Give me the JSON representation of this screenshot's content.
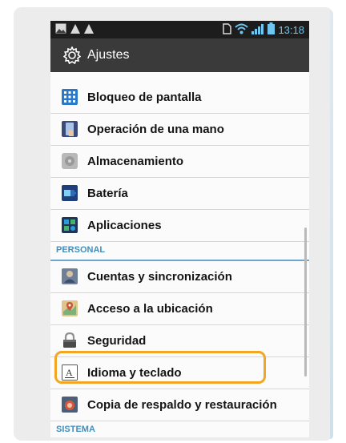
{
  "status_bar": {
    "time": "13:18",
    "icons": [
      "image-icon",
      "warning-icon",
      "warning-icon",
      "sim-icon",
      "wifi-icon",
      "signal-icon",
      "battery-icon"
    ]
  },
  "action_bar": {
    "icon": "gear-icon",
    "title": "Ajustes"
  },
  "list": {
    "items_top": [
      {
        "label": "Bloqueo de pantalla",
        "icon": "grid-lock-icon",
        "color": "#2a78c8"
      },
      {
        "label": "Operación de una mano",
        "icon": "hand-icon",
        "color": "#3a4a7a"
      },
      {
        "label": "Almacenamiento",
        "icon": "storage-icon",
        "color": "#9a9a9a"
      },
      {
        "label": "Batería",
        "icon": "battery-icon",
        "color": "#2c6db3"
      },
      {
        "label": "Aplicaciones",
        "icon": "apps-icon",
        "color": "#2a9ed4"
      }
    ],
    "section_personal": "PERSONAL",
    "items_personal": [
      {
        "label": "Cuentas y sincronización",
        "icon": "accounts-icon",
        "color": "#6f7f98"
      },
      {
        "label": "Acceso a la ubicación",
        "icon": "location-icon",
        "color": "#c9583a"
      },
      {
        "label": "Seguridad",
        "icon": "padlock-icon",
        "color": "#8f8f8f"
      },
      {
        "label": "Idioma y teclado",
        "icon": "keyboard-letter-icon",
        "color": "#ffffff"
      },
      {
        "label": "Copia de respaldo y restauración",
        "icon": "backup-icon",
        "color": "#d6573a"
      }
    ],
    "section_system": "SISTEMA"
  },
  "colors": {
    "accent": "#3f8fbf",
    "highlight": "#f2a623"
  }
}
